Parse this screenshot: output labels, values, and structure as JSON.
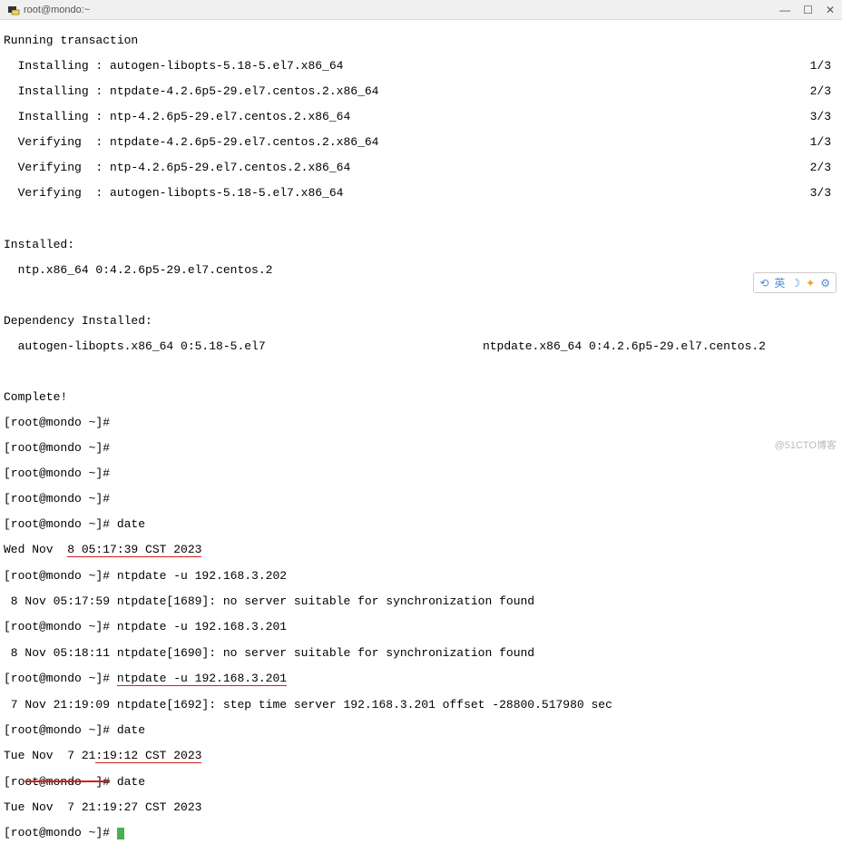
{
  "window": {
    "title": "root@mondo:~"
  },
  "win_controls": {
    "minimize": "—",
    "maximize": "☐",
    "close": "✕"
  },
  "transaction": {
    "header": "Running transaction",
    "rows": [
      {
        "action": "  Installing : autogen-libopts-5.18-5.el7.x86_64",
        "count": "1/3"
      },
      {
        "action": "  Installing : ntpdate-4.2.6p5-29.el7.centos.2.x86_64",
        "count": "2/3"
      },
      {
        "action": "  Installing : ntp-4.2.6p5-29.el7.centos.2.x86_64",
        "count": "3/3"
      },
      {
        "action": "  Verifying  : ntpdate-4.2.6p5-29.el7.centos.2.x86_64",
        "count": "1/3"
      },
      {
        "action": "  Verifying  : ntp-4.2.6p5-29.el7.centos.2.x86_64",
        "count": "2/3"
      },
      {
        "action": "  Verifying  : autogen-libopts-5.18-5.el7.x86_64",
        "count": "3/3"
      }
    ]
  },
  "installed": {
    "header": "Installed:",
    "pkg": "  ntp.x86_64 0:4.2.6p5-29.el7.centos.2"
  },
  "dep_installed": {
    "header": "Dependency Installed:",
    "pkg1": "  autogen-libopts.x86_64 0:5.18-5.el7",
    "pkg2": "ntpdate.x86_64 0:4.2.6p5-29.el7.centos.2"
  },
  "complete": "Complete!",
  "prompts": {
    "p1": "[root@mondo ~]#",
    "p2": "[root@mondo ~]#",
    "p3": "[root@mondo ~]#",
    "p4": "[root@mondo ~]#",
    "p5": "[root@mondo ~]# date",
    "date_out1_a": "Wed Nov  ",
    "date_out1_b": "8 05:17:39 CST 2023",
    "p6": "[root@mondo ~]# ntpdate -u 192.168.3.202",
    "out6": " 8 Nov 05:17:59 ntpdate[1689]: no server suitable for synchronization found",
    "p7": "[root@mondo ~]# ntpdate -u 192.168.3.201",
    "out7": " 8 Nov 05:18:11 ntpdate[1690]: no server suitable for synchronization found",
    "p8a": "[root@mondo ~]# ",
    "p8b": "ntpdate -u 192.168.3.201",
    "out8": " 7 Nov 21:19:09 ntpdate[1692]: step time server 192.168.3.201 offset -28800.517980 sec",
    "p9": "[root@mondo ~]# date",
    "date_out2_a": "Tue Nov  7 21",
    "date_out2_b": ":19:12 CST 2023",
    "p10a": "[ro",
    "p10b": "ot@mondo ~]#",
    "p10c": " date",
    "date_out3": "Tue Nov  7 21:19:27 CST 2023",
    "p11": "[root@mondo ~]# "
  },
  "toolbar": {
    "translate": "⟲",
    "lang": "英",
    "moon": "☽",
    "star": "✦",
    "gear": "⚙"
  },
  "watermark": "@51CTO博客"
}
